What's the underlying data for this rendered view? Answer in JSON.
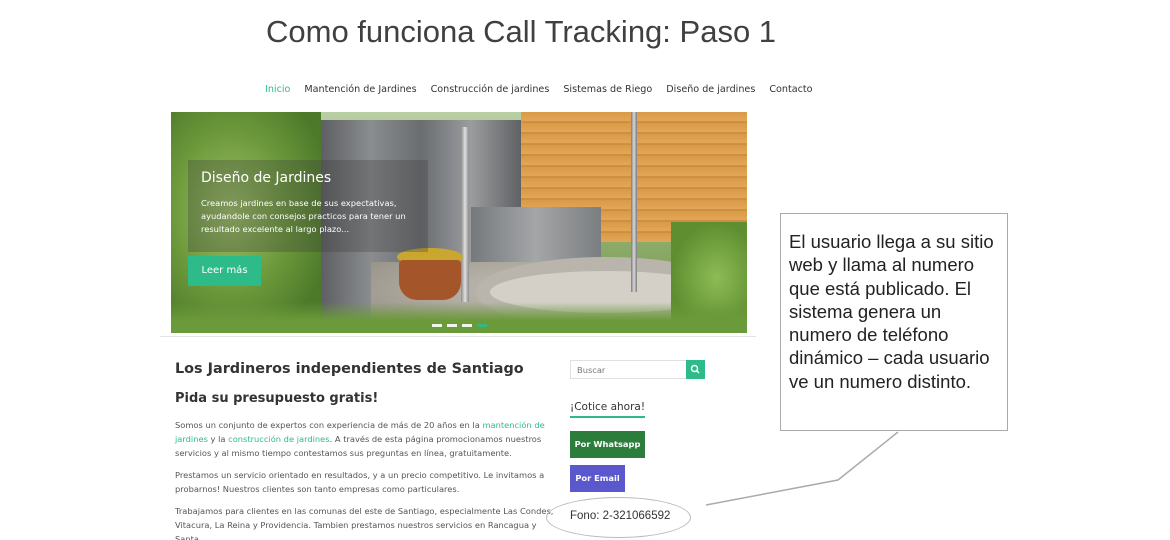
{
  "slide": {
    "title": "Como funciona Call Tracking: Paso 1"
  },
  "nav": {
    "items": [
      {
        "label": "Inicio"
      },
      {
        "label": "Mantención de Jardines"
      },
      {
        "label": "Construcción de jardines"
      },
      {
        "label": "Sistemas de Riego"
      },
      {
        "label": "Diseño de jardines"
      },
      {
        "label": "Contacto"
      }
    ],
    "active_index": 0
  },
  "hero": {
    "title": "Diseño de Jardines",
    "text": "Creamos jardines en base de sus expectativas, ayudandole con consejos practicos para tener un resultado excelente al largo plazo...",
    "button_label": "Leer más",
    "slide_count": 4,
    "active_slide": 4
  },
  "content": {
    "heading": "Los Jardineros independientes de Santiago",
    "subheading": "Pida su presupuesto gratis!",
    "p1_before": "Somos un conjunto de expertos con experiencia de más de 20 años en la ",
    "p1_link1": "mantención de jardines",
    "p1_middle": " y la ",
    "p1_link2": "construcción de jardines",
    "p1_after": ". A través de esta página promocionamos nuestros servicios y al mismo tiempo contestamos sus preguntas en línea, gratuitamente.",
    "p2": "Prestamos un servicio orientado en resultados, y a un precio competitivo. Le invitamos a probarnos! Nuestros clientes son tanto empresas como particulares.",
    "p3": "Trabajamos para clientes en las comunas del este de Santiago, especialmente Las Condes, Vitacura, La Reina y Providencia. Tambien prestamos nuestros servicios en Rancagua y Santa"
  },
  "sidebar": {
    "search_placeholder": "Buscar",
    "cta_heading": "¡Cotice ahora!",
    "whatsapp_label": "Por Whatsapp",
    "email_label": "Por Email",
    "phone_text": "Fono: 2-321066592"
  },
  "callout": {
    "text": "El usuario llega a su sitio web y llama al numero que está publicado.  El sistema genera un numero de teléfono dinámico – cada usuario ve un numero distinto."
  },
  "colors": {
    "accent": "#2ebb8a",
    "whatsapp": "#2c7d3b",
    "email": "#5a58cc"
  }
}
